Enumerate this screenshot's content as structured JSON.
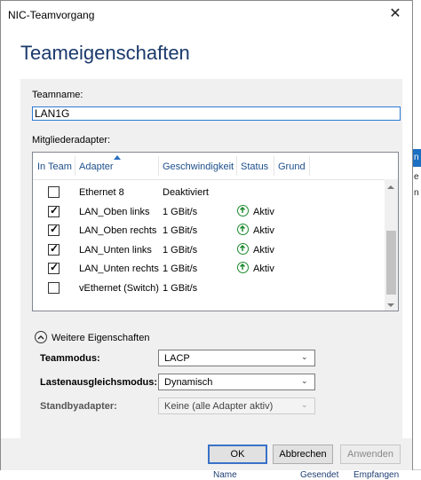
{
  "window": {
    "title": "NIC-Teamvorgang",
    "close_glyph": "✕"
  },
  "heading": "Teameigenschaften",
  "team_name": {
    "label": "Teamname:",
    "value": "LAN1G"
  },
  "members": {
    "label": "Mitgliederadapter:",
    "columns": {
      "in_team": "In Team",
      "adapter": "Adapter",
      "speed": "Geschwindigkeit",
      "status": "Status",
      "reason": "Grund"
    },
    "rows": [
      {
        "checked": false,
        "adapter": "Ethernet 8",
        "speed": "Deaktiviert",
        "status": ""
      },
      {
        "checked": true,
        "adapter": "LAN_Oben links",
        "speed": "1 GBit/s",
        "status": "Aktiv"
      },
      {
        "checked": true,
        "adapter": "LAN_Oben rechts",
        "speed": "1 GBit/s",
        "status": "Aktiv"
      },
      {
        "checked": true,
        "adapter": "LAN_Unten links",
        "speed": "1 GBit/s",
        "status": "Aktiv"
      },
      {
        "checked": true,
        "adapter": "LAN_Unten rechts",
        "speed": "1 GBit/s",
        "status": "Aktiv"
      },
      {
        "checked": false,
        "adapter": "vEthernet (Switch)",
        "speed": "1 GBit/s",
        "status": ""
      }
    ],
    "status_icon": "arrow-up-circle-icon",
    "status_color": "#1e8a2e"
  },
  "more_properties": {
    "label": "Weitere Eigenschaften"
  },
  "properties": {
    "team_mode": {
      "label": "Teammodus:",
      "value": "LACP"
    },
    "load_balancing": {
      "label": "Lastenausgleichsmodus:",
      "value": "Dynamisch"
    },
    "standby": {
      "label": "Standbyadapter:",
      "value": "Keine (alle Adapter aktiv)"
    }
  },
  "buttons": {
    "ok": "OK",
    "cancel": "Abbrechen",
    "apply": "Anwenden"
  },
  "background": {
    "right_fragments": [
      "n",
      "e",
      "n"
    ],
    "bottom_fragments": [
      "Name",
      "Gesendet",
      "Empfangen"
    ]
  },
  "colors": {
    "accent": "#1c6fc1",
    "heading": "#1a3a6b",
    "header_text": "#1c4e8a"
  }
}
